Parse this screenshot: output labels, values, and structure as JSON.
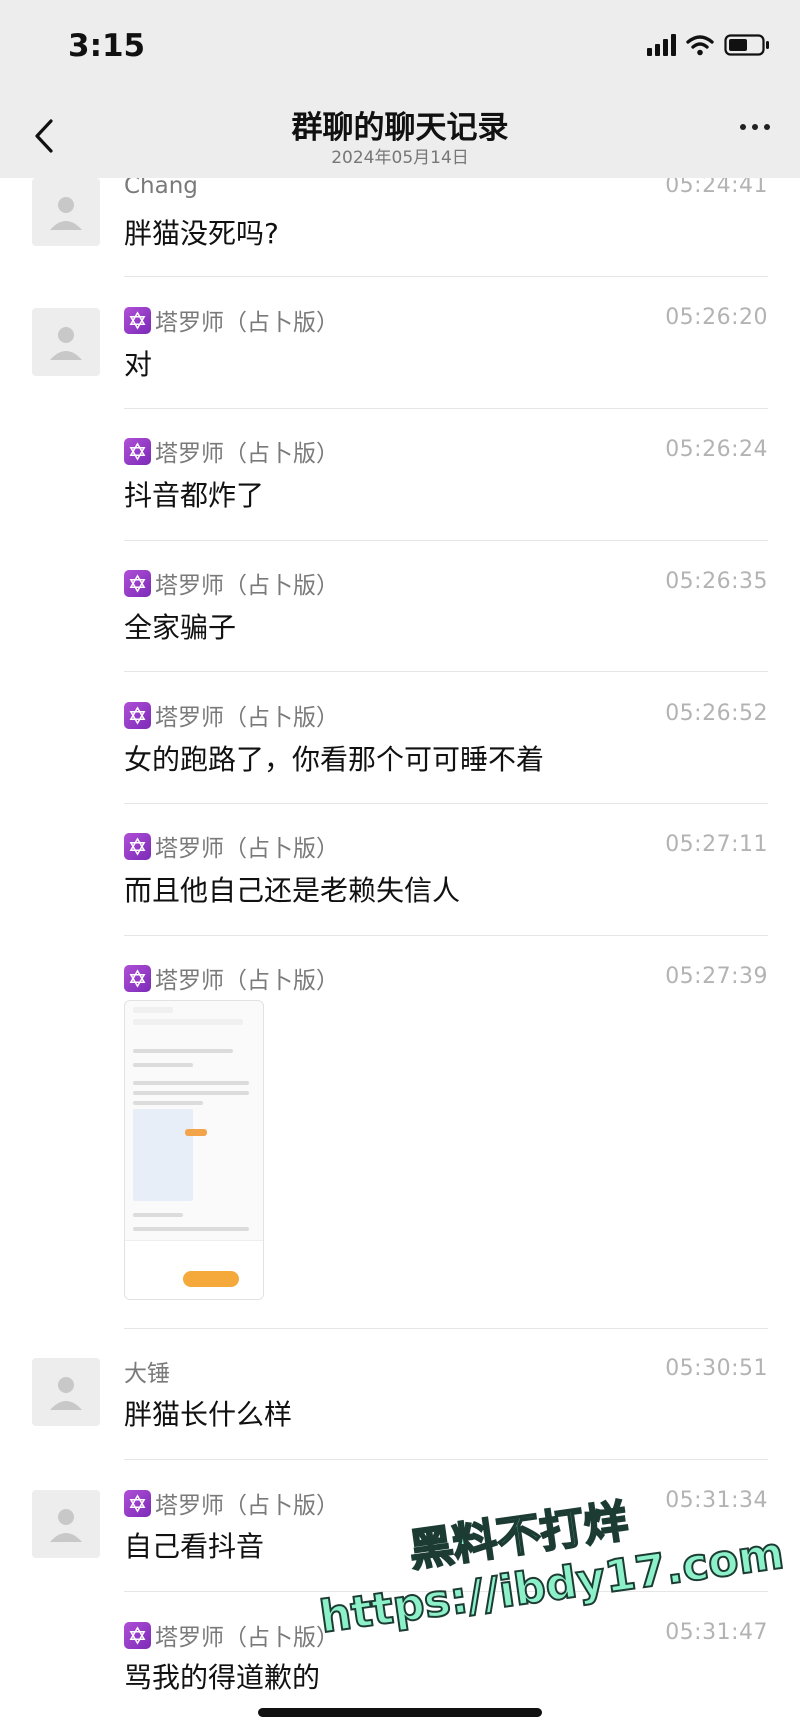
{
  "status_bar": {
    "time": "3:15"
  },
  "nav": {
    "title": "群聊的聊天记录",
    "subtitle": "2024年05月14日"
  },
  "messages": [
    {
      "sender": "Chang",
      "time": "05:24:41",
      "text": "胖猫没死吗?"
    },
    {
      "sender": "塔罗师（占卜版）",
      "time": "05:26:20",
      "text": "对"
    },
    {
      "sender": "塔罗师（占卜版）",
      "time": "05:26:24",
      "text": "抖音都炸了"
    },
    {
      "sender": "塔罗师（占卜版）",
      "time": "05:26:35",
      "text": "全家骗子"
    },
    {
      "sender": "塔罗师（占卜版）",
      "time": "05:26:52",
      "text": "女的跑路了，你看那个可可睡不着"
    },
    {
      "sender": "塔罗师（占卜版）",
      "time": "05:27:11",
      "text": "而且他自己还是老赖失信人"
    },
    {
      "sender": "塔罗师（占卜版）",
      "time": "05:27:39",
      "text": ""
    },
    {
      "sender": "大锤",
      "time": "05:30:51",
      "text": "胖猫长什么样"
    },
    {
      "sender": "塔罗师（占卜版）",
      "time": "05:31:34",
      "text": "自己看抖音"
    },
    {
      "sender": "塔罗师（占卜版）",
      "time": "05:31:47",
      "text": "骂我的得道歉的"
    }
  ],
  "watermark": {
    "line1": "黑料不打烊",
    "line2": "https://ibdy17.com"
  },
  "icons": [
    "back-icon",
    "more-icon",
    "avatar-icon",
    "tarot-badge-icon",
    "signal-icon",
    "wifi-icon",
    "battery-icon"
  ]
}
